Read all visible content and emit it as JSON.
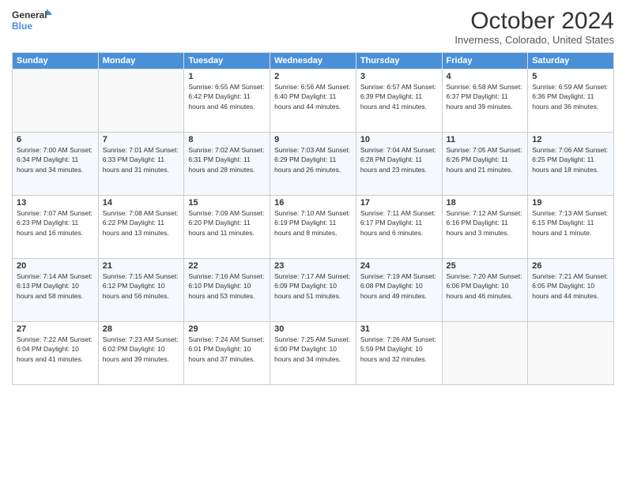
{
  "logo": {
    "line1": "General",
    "line2": "Blue"
  },
  "title": "October 2024",
  "subtitle": "Inverness, Colorado, United States",
  "days_header": [
    "Sunday",
    "Monday",
    "Tuesday",
    "Wednesday",
    "Thursday",
    "Friday",
    "Saturday"
  ],
  "weeks": [
    [
      {
        "day": "",
        "info": ""
      },
      {
        "day": "",
        "info": ""
      },
      {
        "day": "1",
        "info": "Sunrise: 6:55 AM\nSunset: 6:42 PM\nDaylight: 11 hours and 46 minutes."
      },
      {
        "day": "2",
        "info": "Sunrise: 6:56 AM\nSunset: 6:40 PM\nDaylight: 11 hours and 44 minutes."
      },
      {
        "day": "3",
        "info": "Sunrise: 6:57 AM\nSunset: 6:39 PM\nDaylight: 11 hours and 41 minutes."
      },
      {
        "day": "4",
        "info": "Sunrise: 6:58 AM\nSunset: 6:37 PM\nDaylight: 11 hours and 39 minutes."
      },
      {
        "day": "5",
        "info": "Sunrise: 6:59 AM\nSunset: 6:36 PM\nDaylight: 11 hours and 36 minutes."
      }
    ],
    [
      {
        "day": "6",
        "info": "Sunrise: 7:00 AM\nSunset: 6:34 PM\nDaylight: 11 hours and 34 minutes."
      },
      {
        "day": "7",
        "info": "Sunrise: 7:01 AM\nSunset: 6:33 PM\nDaylight: 11 hours and 31 minutes."
      },
      {
        "day": "8",
        "info": "Sunrise: 7:02 AM\nSunset: 6:31 PM\nDaylight: 11 hours and 28 minutes."
      },
      {
        "day": "9",
        "info": "Sunrise: 7:03 AM\nSunset: 6:29 PM\nDaylight: 11 hours and 26 minutes."
      },
      {
        "day": "10",
        "info": "Sunrise: 7:04 AM\nSunset: 6:28 PM\nDaylight: 11 hours and 23 minutes."
      },
      {
        "day": "11",
        "info": "Sunrise: 7:05 AM\nSunset: 6:26 PM\nDaylight: 11 hours and 21 minutes."
      },
      {
        "day": "12",
        "info": "Sunrise: 7:06 AM\nSunset: 6:25 PM\nDaylight: 11 hours and 18 minutes."
      }
    ],
    [
      {
        "day": "13",
        "info": "Sunrise: 7:07 AM\nSunset: 6:23 PM\nDaylight: 11 hours and 16 minutes."
      },
      {
        "day": "14",
        "info": "Sunrise: 7:08 AM\nSunset: 6:22 PM\nDaylight: 11 hours and 13 minutes."
      },
      {
        "day": "15",
        "info": "Sunrise: 7:09 AM\nSunset: 6:20 PM\nDaylight: 11 hours and 11 minutes."
      },
      {
        "day": "16",
        "info": "Sunrise: 7:10 AM\nSunset: 6:19 PM\nDaylight: 11 hours and 8 minutes."
      },
      {
        "day": "17",
        "info": "Sunrise: 7:11 AM\nSunset: 6:17 PM\nDaylight: 11 hours and 6 minutes."
      },
      {
        "day": "18",
        "info": "Sunrise: 7:12 AM\nSunset: 6:16 PM\nDaylight: 11 hours and 3 minutes."
      },
      {
        "day": "19",
        "info": "Sunrise: 7:13 AM\nSunset: 6:15 PM\nDaylight: 11 hours and 1 minute."
      }
    ],
    [
      {
        "day": "20",
        "info": "Sunrise: 7:14 AM\nSunset: 6:13 PM\nDaylight: 10 hours and 58 minutes."
      },
      {
        "day": "21",
        "info": "Sunrise: 7:15 AM\nSunset: 6:12 PM\nDaylight: 10 hours and 56 minutes."
      },
      {
        "day": "22",
        "info": "Sunrise: 7:16 AM\nSunset: 6:10 PM\nDaylight: 10 hours and 53 minutes."
      },
      {
        "day": "23",
        "info": "Sunrise: 7:17 AM\nSunset: 6:09 PM\nDaylight: 10 hours and 51 minutes."
      },
      {
        "day": "24",
        "info": "Sunrise: 7:19 AM\nSunset: 6:08 PM\nDaylight: 10 hours and 49 minutes."
      },
      {
        "day": "25",
        "info": "Sunrise: 7:20 AM\nSunset: 6:06 PM\nDaylight: 10 hours and 46 minutes."
      },
      {
        "day": "26",
        "info": "Sunrise: 7:21 AM\nSunset: 6:05 PM\nDaylight: 10 hours and 44 minutes."
      }
    ],
    [
      {
        "day": "27",
        "info": "Sunrise: 7:22 AM\nSunset: 6:04 PM\nDaylight: 10 hours and 41 minutes."
      },
      {
        "day": "28",
        "info": "Sunrise: 7:23 AM\nSunset: 6:02 PM\nDaylight: 10 hours and 39 minutes."
      },
      {
        "day": "29",
        "info": "Sunrise: 7:24 AM\nSunset: 6:01 PM\nDaylight: 10 hours and 37 minutes."
      },
      {
        "day": "30",
        "info": "Sunrise: 7:25 AM\nSunset: 6:00 PM\nDaylight: 10 hours and 34 minutes."
      },
      {
        "day": "31",
        "info": "Sunrise: 7:26 AM\nSunset: 5:59 PM\nDaylight: 10 hours and 32 minutes."
      },
      {
        "day": "",
        "info": ""
      },
      {
        "day": "",
        "info": ""
      }
    ]
  ]
}
